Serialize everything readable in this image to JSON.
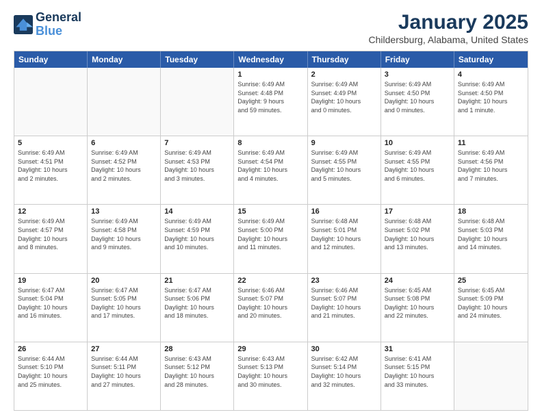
{
  "logo": {
    "line1": "General",
    "line2": "Blue"
  },
  "header": {
    "title": "January 2025",
    "subtitle": "Childersburg, Alabama, United States"
  },
  "weekdays": [
    "Sunday",
    "Monday",
    "Tuesday",
    "Wednesday",
    "Thursday",
    "Friday",
    "Saturday"
  ],
  "weeks": [
    [
      {
        "day": "",
        "info": ""
      },
      {
        "day": "",
        "info": ""
      },
      {
        "day": "",
        "info": ""
      },
      {
        "day": "1",
        "info": "Sunrise: 6:49 AM\nSunset: 4:48 PM\nDaylight: 9 hours\nand 59 minutes."
      },
      {
        "day": "2",
        "info": "Sunrise: 6:49 AM\nSunset: 4:49 PM\nDaylight: 10 hours\nand 0 minutes."
      },
      {
        "day": "3",
        "info": "Sunrise: 6:49 AM\nSunset: 4:50 PM\nDaylight: 10 hours\nand 0 minutes."
      },
      {
        "day": "4",
        "info": "Sunrise: 6:49 AM\nSunset: 4:50 PM\nDaylight: 10 hours\nand 1 minute."
      }
    ],
    [
      {
        "day": "5",
        "info": "Sunrise: 6:49 AM\nSunset: 4:51 PM\nDaylight: 10 hours\nand 2 minutes."
      },
      {
        "day": "6",
        "info": "Sunrise: 6:49 AM\nSunset: 4:52 PM\nDaylight: 10 hours\nand 2 minutes."
      },
      {
        "day": "7",
        "info": "Sunrise: 6:49 AM\nSunset: 4:53 PM\nDaylight: 10 hours\nand 3 minutes."
      },
      {
        "day": "8",
        "info": "Sunrise: 6:49 AM\nSunset: 4:54 PM\nDaylight: 10 hours\nand 4 minutes."
      },
      {
        "day": "9",
        "info": "Sunrise: 6:49 AM\nSunset: 4:55 PM\nDaylight: 10 hours\nand 5 minutes."
      },
      {
        "day": "10",
        "info": "Sunrise: 6:49 AM\nSunset: 4:55 PM\nDaylight: 10 hours\nand 6 minutes."
      },
      {
        "day": "11",
        "info": "Sunrise: 6:49 AM\nSunset: 4:56 PM\nDaylight: 10 hours\nand 7 minutes."
      }
    ],
    [
      {
        "day": "12",
        "info": "Sunrise: 6:49 AM\nSunset: 4:57 PM\nDaylight: 10 hours\nand 8 minutes."
      },
      {
        "day": "13",
        "info": "Sunrise: 6:49 AM\nSunset: 4:58 PM\nDaylight: 10 hours\nand 9 minutes."
      },
      {
        "day": "14",
        "info": "Sunrise: 6:49 AM\nSunset: 4:59 PM\nDaylight: 10 hours\nand 10 minutes."
      },
      {
        "day": "15",
        "info": "Sunrise: 6:49 AM\nSunset: 5:00 PM\nDaylight: 10 hours\nand 11 minutes."
      },
      {
        "day": "16",
        "info": "Sunrise: 6:48 AM\nSunset: 5:01 PM\nDaylight: 10 hours\nand 12 minutes."
      },
      {
        "day": "17",
        "info": "Sunrise: 6:48 AM\nSunset: 5:02 PM\nDaylight: 10 hours\nand 13 minutes."
      },
      {
        "day": "18",
        "info": "Sunrise: 6:48 AM\nSunset: 5:03 PM\nDaylight: 10 hours\nand 14 minutes."
      }
    ],
    [
      {
        "day": "19",
        "info": "Sunrise: 6:47 AM\nSunset: 5:04 PM\nDaylight: 10 hours\nand 16 minutes."
      },
      {
        "day": "20",
        "info": "Sunrise: 6:47 AM\nSunset: 5:05 PM\nDaylight: 10 hours\nand 17 minutes."
      },
      {
        "day": "21",
        "info": "Sunrise: 6:47 AM\nSunset: 5:06 PM\nDaylight: 10 hours\nand 18 minutes."
      },
      {
        "day": "22",
        "info": "Sunrise: 6:46 AM\nSunset: 5:07 PM\nDaylight: 10 hours\nand 20 minutes."
      },
      {
        "day": "23",
        "info": "Sunrise: 6:46 AM\nSunset: 5:07 PM\nDaylight: 10 hours\nand 21 minutes."
      },
      {
        "day": "24",
        "info": "Sunrise: 6:45 AM\nSunset: 5:08 PM\nDaylight: 10 hours\nand 22 minutes."
      },
      {
        "day": "25",
        "info": "Sunrise: 6:45 AM\nSunset: 5:09 PM\nDaylight: 10 hours\nand 24 minutes."
      }
    ],
    [
      {
        "day": "26",
        "info": "Sunrise: 6:44 AM\nSunset: 5:10 PM\nDaylight: 10 hours\nand 25 minutes."
      },
      {
        "day": "27",
        "info": "Sunrise: 6:44 AM\nSunset: 5:11 PM\nDaylight: 10 hours\nand 27 minutes."
      },
      {
        "day": "28",
        "info": "Sunrise: 6:43 AM\nSunset: 5:12 PM\nDaylight: 10 hours\nand 28 minutes."
      },
      {
        "day": "29",
        "info": "Sunrise: 6:43 AM\nSunset: 5:13 PM\nDaylight: 10 hours\nand 30 minutes."
      },
      {
        "day": "30",
        "info": "Sunrise: 6:42 AM\nSunset: 5:14 PM\nDaylight: 10 hours\nand 32 minutes."
      },
      {
        "day": "31",
        "info": "Sunrise: 6:41 AM\nSunset: 5:15 PM\nDaylight: 10 hours\nand 33 minutes."
      },
      {
        "day": "",
        "info": ""
      }
    ]
  ]
}
